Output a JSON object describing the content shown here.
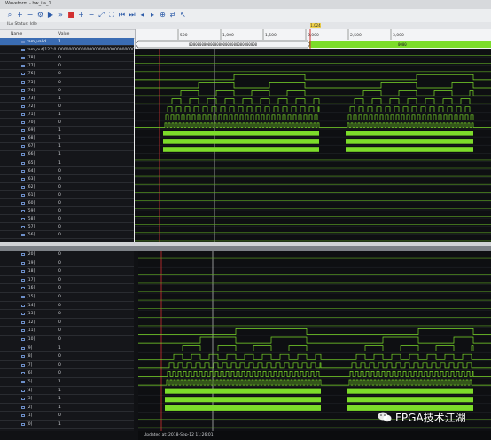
{
  "window": {
    "title": "Waveform - hw_ila_1"
  },
  "toolbar": {
    "icons": [
      "search-icon",
      "zoom-in-icon",
      "zoom-out-icon",
      "settings-icon",
      "play-icon",
      "fast-forward-icon",
      "stop-icon",
      "zoom-in-icon",
      "zoom-out-icon",
      "zoom-fit-icon",
      "zoom-full-icon",
      "go-start-icon",
      "go-end-icon",
      "prev-marker-icon",
      "next-marker-icon",
      "add-marker-icon",
      "swap-icon",
      "cursor-icon"
    ]
  },
  "status": {
    "text": "ILA Status: Idle"
  },
  "columns": {
    "name": "Name",
    "value": "Value"
  },
  "top": {
    "signals": [
      {
        "name": "ram_valid",
        "value": "1",
        "highlight": true
      },
      {
        "name": "ram_out[127:0]",
        "value": "0000000000000000000000000000000000000000000000000000000000000000"
      },
      {
        "name": "[78]",
        "value": "0"
      },
      {
        "name": "[77]",
        "value": "0"
      },
      {
        "name": "[76]",
        "value": "0"
      },
      {
        "name": "[75]",
        "value": "0"
      },
      {
        "name": "[74]",
        "value": "0"
      },
      {
        "name": "[73]",
        "value": "1"
      },
      {
        "name": "[72]",
        "value": "0"
      },
      {
        "name": "[71]",
        "value": "1"
      },
      {
        "name": "[70]",
        "value": "0"
      },
      {
        "name": "[69]",
        "value": "1"
      },
      {
        "name": "[68]",
        "value": "1"
      },
      {
        "name": "[67]",
        "value": "1"
      },
      {
        "name": "[66]",
        "value": "1"
      },
      {
        "name": "[65]",
        "value": "1"
      },
      {
        "name": "[64]",
        "value": "0"
      },
      {
        "name": "[63]",
        "value": "0"
      },
      {
        "name": "[62]",
        "value": "0"
      },
      {
        "name": "[61]",
        "value": "0"
      },
      {
        "name": "[60]",
        "value": "0"
      },
      {
        "name": "[59]",
        "value": "0"
      },
      {
        "name": "[58]",
        "value": "0"
      },
      {
        "name": "[57]",
        "value": "0"
      },
      {
        "name": "[56]",
        "value": "0"
      }
    ],
    "ruler_ticks": [
      "500",
      "1,000",
      "1,500",
      "2,000",
      "2,500",
      "3,000"
    ],
    "trigger_label": "1,024",
    "bus_value": "00000000000000000000000000000000",
    "bus_value_right": "0000"
  },
  "bottom": {
    "signals": [
      {
        "name": "[20]",
        "value": "0"
      },
      {
        "name": "[19]",
        "value": "0"
      },
      {
        "name": "[18]",
        "value": "0"
      },
      {
        "name": "[17]",
        "value": "0"
      },
      {
        "name": "[16]",
        "value": "0"
      },
      {
        "name": "[15]",
        "value": "0"
      },
      {
        "name": "[14]",
        "value": "0"
      },
      {
        "name": "[13]",
        "value": "0"
      },
      {
        "name": "[12]",
        "value": "0"
      },
      {
        "name": "[11]",
        "value": "0"
      },
      {
        "name": "[10]",
        "value": "0"
      },
      {
        "name": "[9]",
        "value": "1"
      },
      {
        "name": "[8]",
        "value": "0"
      },
      {
        "name": "[7]",
        "value": "0"
      },
      {
        "name": "[6]",
        "value": "0"
      },
      {
        "name": "[5]",
        "value": "1"
      },
      {
        "name": "[4]",
        "value": "1"
      },
      {
        "name": "[3]",
        "value": "1"
      },
      {
        "name": "[2]",
        "value": "1"
      },
      {
        "name": "[1]",
        "value": "0"
      },
      {
        "name": "[0]",
        "value": "1"
      }
    ],
    "updated_text": "Updated at: 2018-Sep-12 11:26:01"
  },
  "watermark": {
    "text": "FPGA技术江湖"
  },
  "colors": {
    "wave": "#7cdc2a",
    "wave_dim": "#5ea824",
    "trigger": "#d23030",
    "cursor": "#e8e8e8",
    "highlight": "#3a6cb3"
  }
}
